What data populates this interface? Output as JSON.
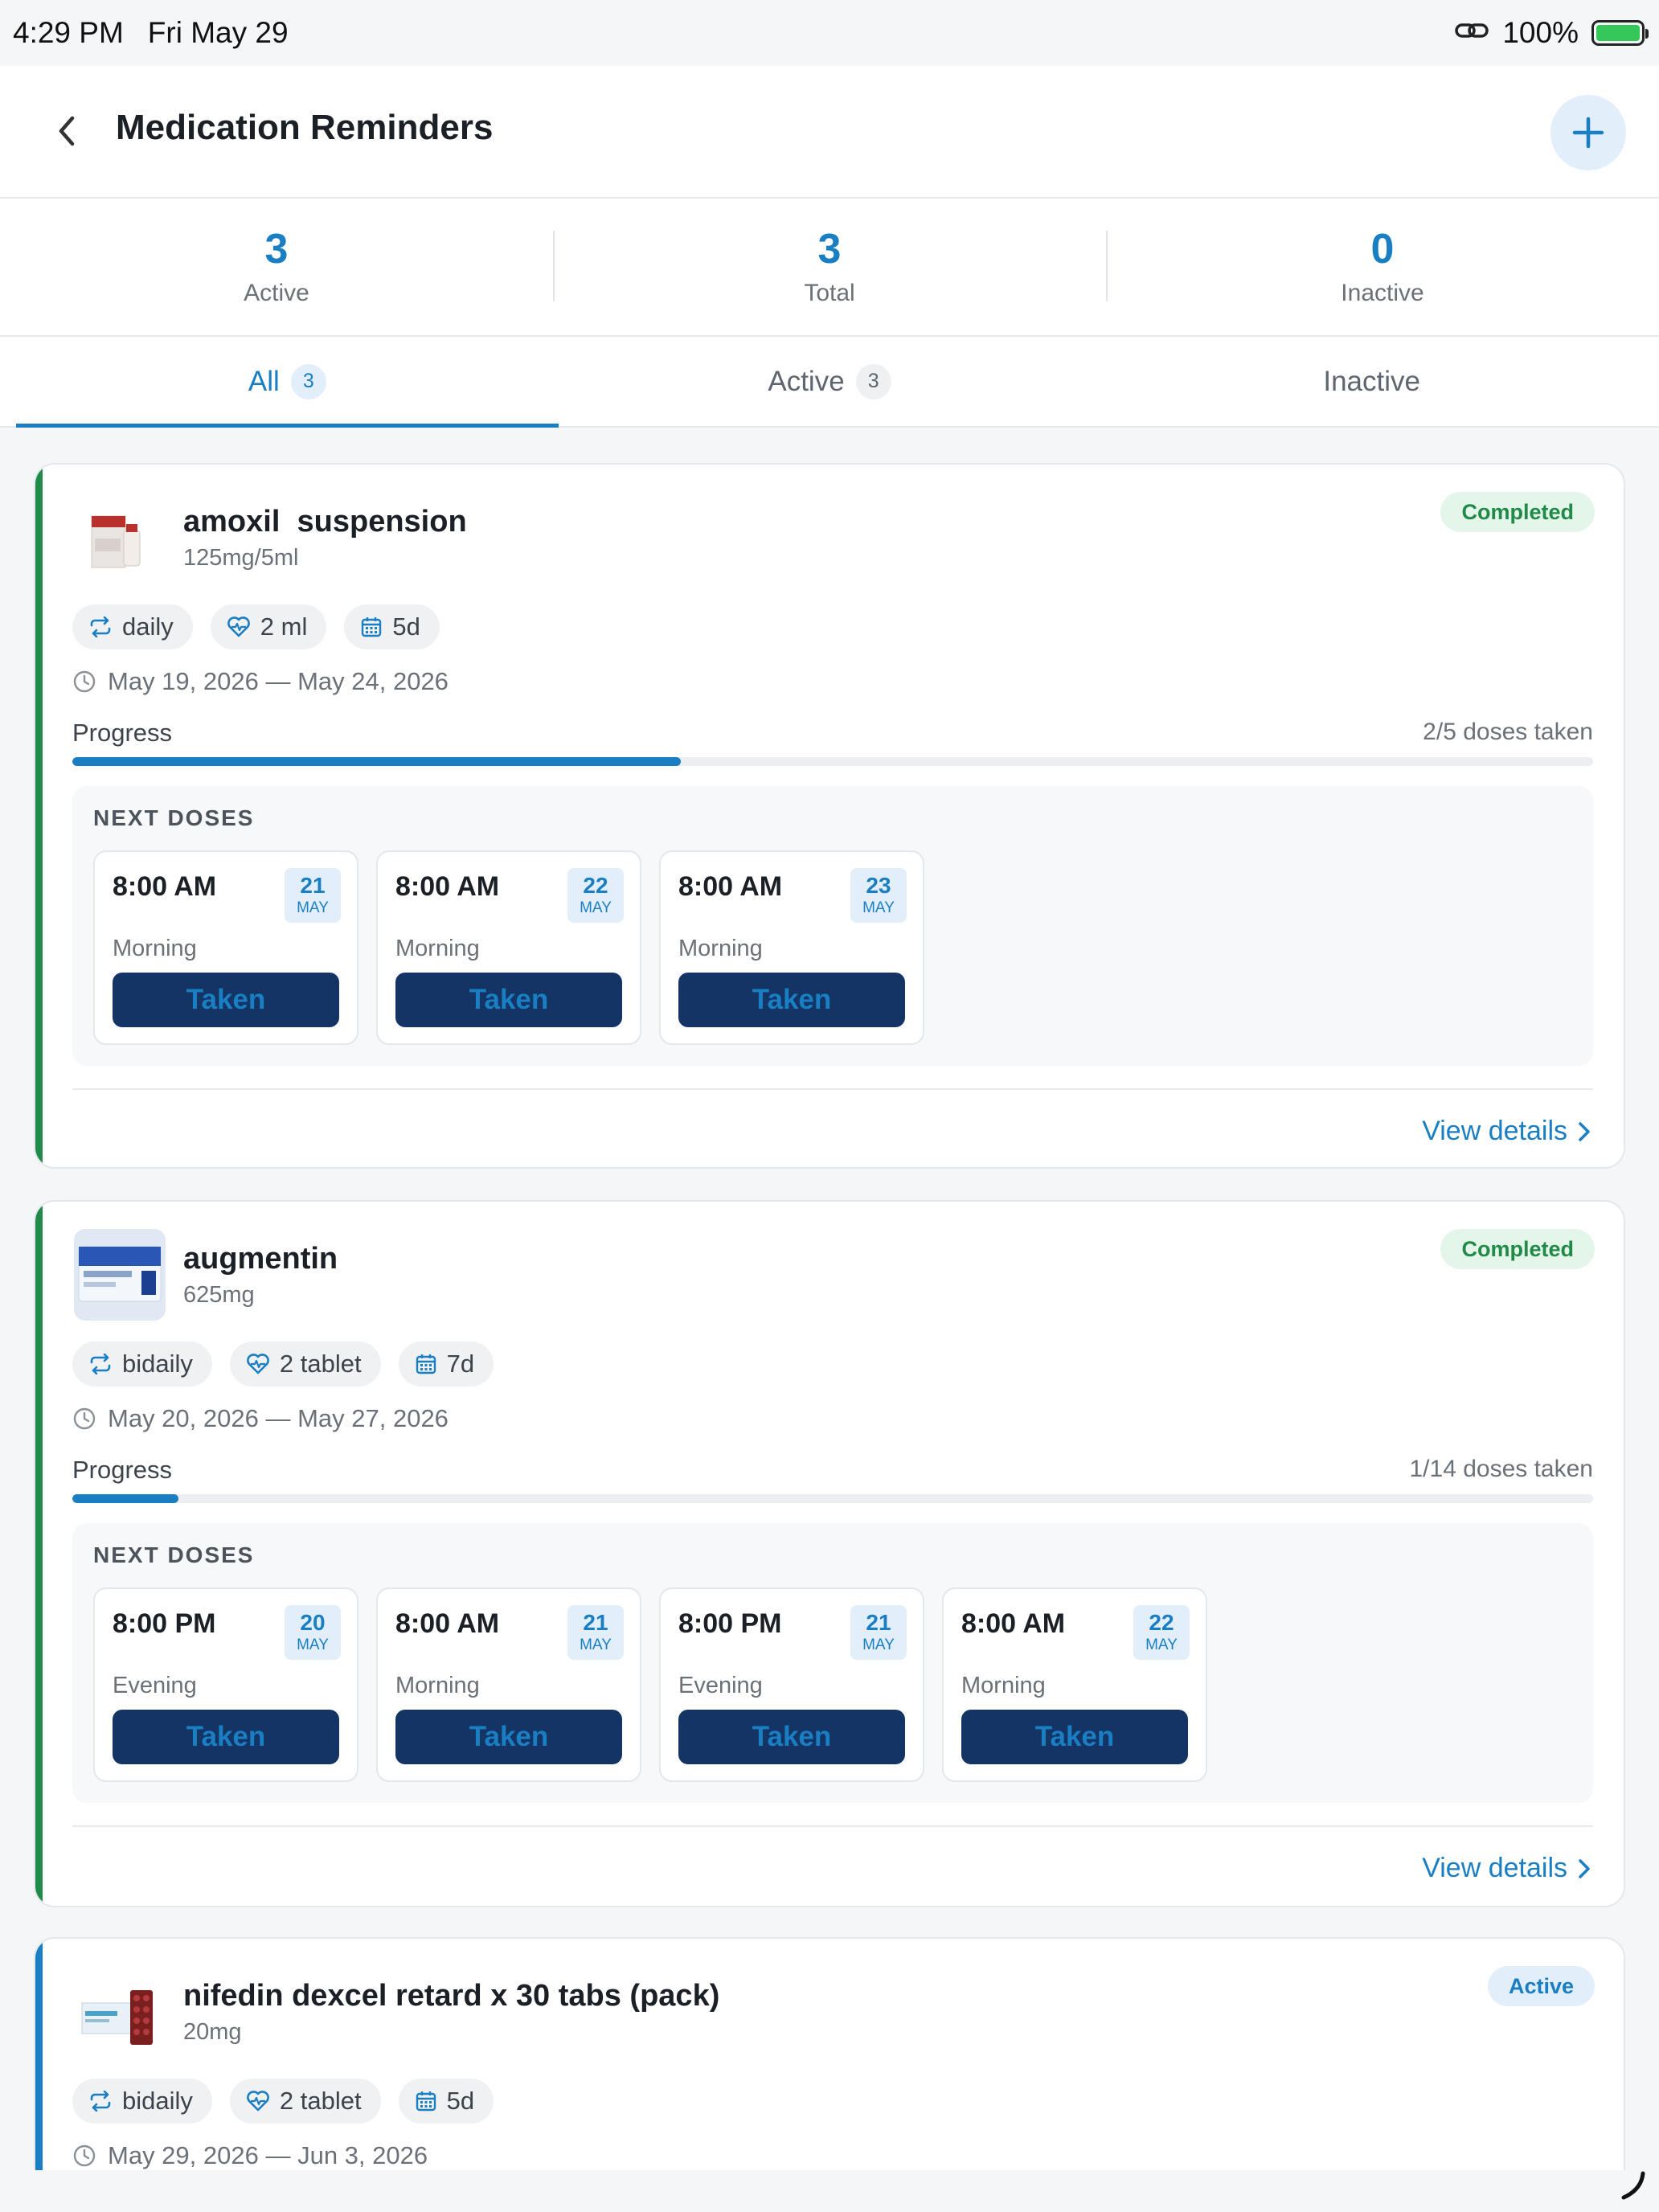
{
  "status_bar": {
    "time": "4:29 PM",
    "date": "Fri May 29",
    "battery": "100%"
  },
  "header": {
    "title": "Medication Reminders"
  },
  "stats": [
    {
      "value": "3",
      "label": "Active"
    },
    {
      "value": "3",
      "label": "Total"
    },
    {
      "value": "0",
      "label": "Inactive"
    }
  ],
  "tabs": [
    {
      "label": "All",
      "count": "3"
    },
    {
      "label": "Active",
      "count": "3"
    },
    {
      "label": "Inactive"
    }
  ],
  "colors": {
    "accent": "#1a7ec2",
    "completed": "#218a48",
    "active_border": "#1a7ec2",
    "button_bg": "#133465"
  },
  "medications": [
    {
      "name": "amoxil  suspension",
      "strength": "125mg/5ml",
      "status": "Completed",
      "frequency": "daily",
      "dose": "2 ml",
      "duration": "5d",
      "date_range": "May 19, 2026 — May 24, 2026",
      "progress_label": "Progress",
      "progress_text": "2/5 doses taken",
      "progress_fraction": 0.4,
      "next_doses_title": "NEXT DOSES",
      "doses": [
        {
          "time": "8:00 AM",
          "day": "21",
          "month": "MAY",
          "period": "Morning",
          "action": "Taken"
        },
        {
          "time": "8:00 AM",
          "day": "22",
          "month": "MAY",
          "period": "Morning",
          "action": "Taken"
        },
        {
          "time": "8:00 AM",
          "day": "23",
          "month": "MAY",
          "period": "Morning",
          "action": "Taken"
        }
      ],
      "view_details": "View details"
    },
    {
      "name": "augmentin",
      "strength": "625mg",
      "status": "Completed",
      "frequency": "bidaily",
      "dose": "2 tablet",
      "duration": "7d",
      "date_range": "May 20, 2026 — May 27, 2026",
      "progress_label": "Progress",
      "progress_text": "1/14 doses taken",
      "progress_fraction": 0.07,
      "next_doses_title": "NEXT DOSES",
      "doses": [
        {
          "time": "8:00 PM",
          "day": "20",
          "month": "MAY",
          "period": "Evening",
          "action": "Taken"
        },
        {
          "time": "8:00 AM",
          "day": "21",
          "month": "MAY",
          "period": "Morning",
          "action": "Taken"
        },
        {
          "time": "8:00 PM",
          "day": "21",
          "month": "MAY",
          "period": "Evening",
          "action": "Taken"
        },
        {
          "time": "8:00 AM",
          "day": "22",
          "month": "MAY",
          "period": "Morning",
          "action": "Taken"
        }
      ],
      "view_details": "View details"
    },
    {
      "name": "nifedin dexcel retard x 30 tabs (pack)",
      "strength": "20mg",
      "status": "Active",
      "frequency": "bidaily",
      "dose": "2 tablet",
      "duration": "5d",
      "date_range": "May 29, 2026 — Jun 3, 2026"
    }
  ]
}
